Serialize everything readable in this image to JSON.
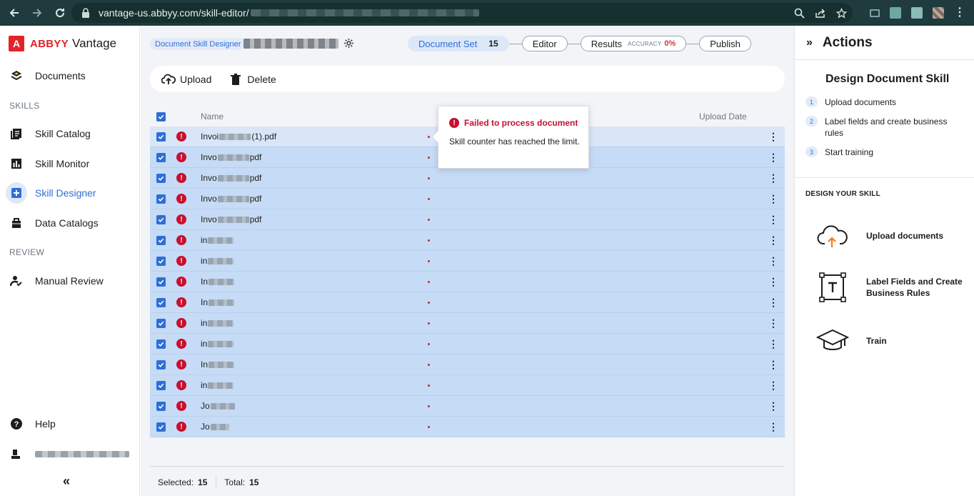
{
  "browser": {
    "url_text": "vantage-us.abbyy.com/skill-editor/"
  },
  "brand": {
    "logo_letter": "A",
    "abbyy": "ABBYY",
    "vantage": "Vantage"
  },
  "sidebar": {
    "documents": "Documents",
    "skills_label": "SKILLS",
    "skill_catalog": "Skill Catalog",
    "skill_monitor": "Skill Monitor",
    "skill_designer": "Skill Designer",
    "data_catalogs": "Data Catalogs",
    "review_label": "REVIEW",
    "manual_review": "Manual Review",
    "help": "Help",
    "collapse": "«"
  },
  "toolbar": {
    "designer_badge": "Document Skill Designer",
    "steps": {
      "document_set": "Document Set",
      "document_set_count": "15",
      "editor": "Editor",
      "results": "Results",
      "accuracy_label": "ACCURACY",
      "accuracy_value": "0%",
      "publish": "Publish"
    }
  },
  "actions": {
    "upload": "Upload",
    "delete": "Delete"
  },
  "table": {
    "col_name": "Name",
    "col_upload_date": "Upload Date",
    "rows": [
      {
        "prefix": "Invoi",
        "suffix": "(1).pdf"
      },
      {
        "prefix": "Invo",
        "suffix": "pdf"
      },
      {
        "prefix": "Invo",
        "suffix": "pdf"
      },
      {
        "prefix": "Invo",
        "suffix": "pdf"
      },
      {
        "prefix": "Invo",
        "suffix": "pdf"
      },
      {
        "prefix": "in",
        "suffix": ""
      },
      {
        "prefix": "in",
        "suffix": ""
      },
      {
        "prefix": "In",
        "suffix": ""
      },
      {
        "prefix": "In",
        "suffix": ""
      },
      {
        "prefix": "in",
        "suffix": ""
      },
      {
        "prefix": "in",
        "suffix": ""
      },
      {
        "prefix": "In",
        "suffix": ""
      },
      {
        "prefix": "in",
        "suffix": ""
      },
      {
        "prefix": "Jo",
        "suffix": ""
      },
      {
        "prefix": "Jo",
        "suffix": ""
      }
    ]
  },
  "tooltip": {
    "title": "Failed to process document",
    "body": "Skill counter has reached the limit."
  },
  "footer": {
    "selected_label": "Selected:",
    "selected_value": "15",
    "total_label": "Total:",
    "total_value": "15"
  },
  "right_panel": {
    "collapse": "»",
    "title": "Actions",
    "subtitle": "Design Document Skill",
    "steps": [
      {
        "num": "1",
        "label": "Upload documents"
      },
      {
        "num": "2",
        "label": "Label fields and create business rules"
      },
      {
        "num": "3",
        "label": "Start training"
      }
    ],
    "section_title": "DESIGN YOUR SKILL",
    "cards": [
      {
        "label": "Upload documents",
        "icon": "cloud-upload-icon"
      },
      {
        "label": "Label Fields and Create Business Rules",
        "icon": "text-field-icon"
      },
      {
        "label": "Train",
        "icon": "graduation-cap-icon"
      }
    ]
  },
  "colors": {
    "brand_red": "#e2232a",
    "accent_blue": "#2e6fd6",
    "error_red": "#c8102e",
    "row_selected": "#c6dbf5"
  }
}
